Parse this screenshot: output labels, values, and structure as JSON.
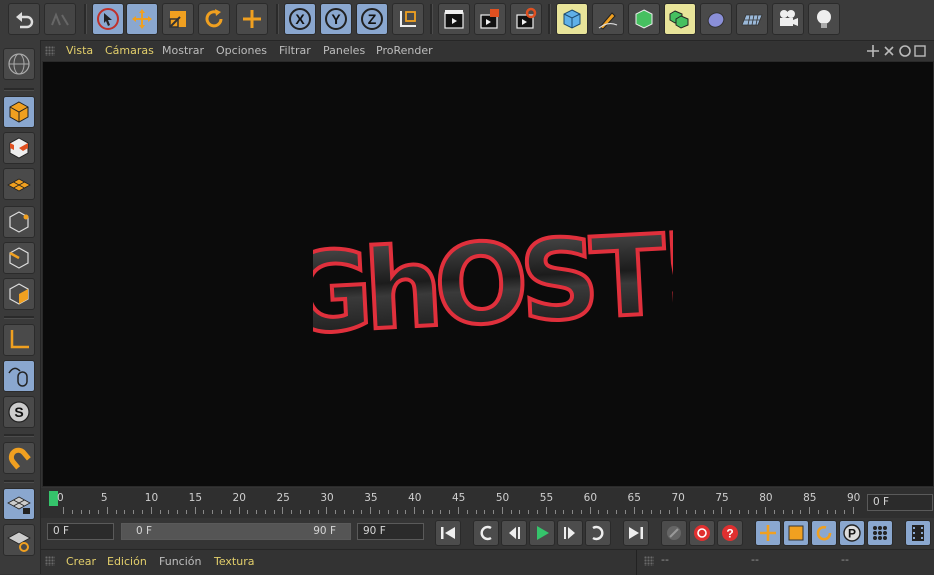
{
  "viewport_menu": {
    "items": [
      "Vista",
      "Cámaras",
      "Mostrar",
      "Opciones",
      "Filtrar",
      "Paneles",
      "ProRender"
    ]
  },
  "toolbar": {
    "axis_x": "X",
    "axis_y": "Y",
    "axis_z": "Z"
  },
  "scene": {
    "title_text": "GhOST!"
  },
  "timeline": {
    "ticks": [
      "0",
      "5",
      "10",
      "15",
      "20",
      "25",
      "30",
      "35",
      "40",
      "45",
      "50",
      "55",
      "60",
      "65",
      "70",
      "75",
      "80",
      "85",
      "90"
    ],
    "end_field": "0 F"
  },
  "transport": {
    "current_frame": "0 F",
    "range_start": "0 F",
    "range_end": "90 F",
    "max_frame": "90 F"
  },
  "bottom_menu": {
    "items": [
      "Crear",
      "Edición",
      "Función",
      "Textura"
    ],
    "right_a": "--",
    "right_b": "--",
    "right_c": "--"
  },
  "colors": {
    "accent_orange": "#f0a020",
    "menu_highlight": "#e3cf6b",
    "tool_blue": "#8aa7cf",
    "playhead_green": "#35c46b"
  }
}
